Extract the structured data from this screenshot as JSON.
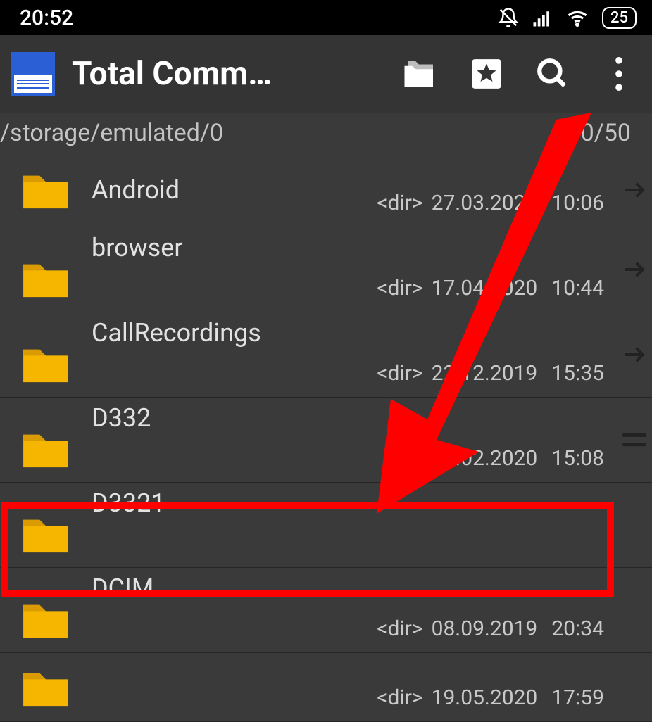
{
  "status": {
    "time": "20:52",
    "battery": "25"
  },
  "header": {
    "title": "Total Comm…"
  },
  "path": {
    "current": "/storage/emulated/0",
    "counter": "0/50"
  },
  "files": [
    {
      "name": "Android",
      "dir": "<dir>",
      "date": "27.03.2020",
      "time": "10:06",
      "handle": "arrow"
    },
    {
      "name": "browser",
      "dir": "<dir>",
      "date": "17.04.2020",
      "time": "10:44",
      "handle": "arrow"
    },
    {
      "name": "CallRecordings",
      "dir": "<dir>",
      "date": "22.12.2019",
      "time": "15:35",
      "handle": "arrow"
    },
    {
      "name": "D332",
      "dir": ">",
      "date": "24.02.2020",
      "time": "15:08",
      "handle": "equals"
    },
    {
      "name": "D3321",
      "dir": "",
      "date": "",
      "time": "",
      "handle": ""
    },
    {
      "name": "DCIM",
      "dir": "<dir>",
      "date": "08.09.2019",
      "time": "20:34",
      "handle": ""
    },
    {
      "name": "",
      "dir": "<dir>",
      "date": "19.05.2020",
      "time": "17:59",
      "handle": ""
    }
  ]
}
